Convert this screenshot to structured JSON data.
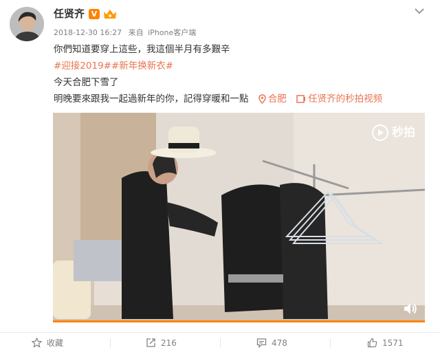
{
  "post": {
    "author": "任贤齐",
    "vip_badge": "V",
    "timestamp": "2018-12-30 16:27",
    "source_prefix": "来自",
    "source": "iPhone客户端",
    "text_line1": "你們知道要穿上這些，我這個半月有多艱辛",
    "hashtags": [
      "#迎接2019#",
      "#新年换新衣#"
    ],
    "text_line3": "今天合肥下雪了",
    "text_line4": "明晚要來跟我一起過新年的你，記得穿暖和一點",
    "location": "合肥",
    "video_link": "任贤齐的秒拍视频"
  },
  "video": {
    "watermark": "秒拍",
    "progress_percent": 100
  },
  "actions": {
    "favorite": "收藏",
    "share_count": "216",
    "comment_count": "478",
    "like_count": "1571"
  },
  "colors": {
    "accent": "#eb7350",
    "brand_orange": "#ff8200",
    "meta_gray": "#808080"
  },
  "icons": {
    "more": "chevron-down-icon",
    "location": "location-pin-icon",
    "video_link": "video-link-icon",
    "volume": "volume-icon",
    "favorite": "star-icon",
    "share": "share-icon",
    "comment": "comment-icon",
    "like": "thumbs-up-icon"
  }
}
